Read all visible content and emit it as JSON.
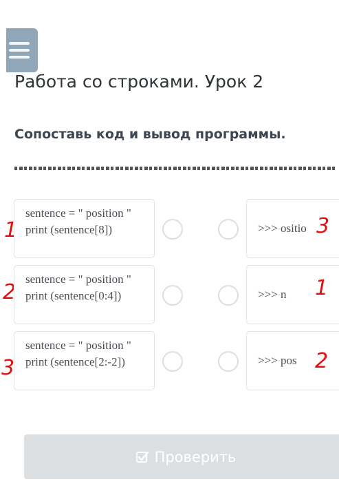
{
  "header": {
    "title": "Работа со строками. Урок 2"
  },
  "task": {
    "instruction": "Сопоставь код и вывод программы."
  },
  "left_items": [
    {
      "code": "sentence = \" position \" print (sentence[8])",
      "handwritten_mark": "1"
    },
    {
      "code": "sentence = \" position \" print (sentence[0:4])",
      "handwritten_mark": "2"
    },
    {
      "code": "sentence = \" position \" print (sentence[2:-2])",
      "handwritten_mark": "3"
    }
  ],
  "right_items": [
    {
      "output": ">>> ositio",
      "handwritten_mark": "3"
    },
    {
      "output": ">>> n",
      "handwritten_mark": "1"
    },
    {
      "output": ">>> pos",
      "handwritten_mark": "2"
    }
  ],
  "check_button": {
    "label": "Проверить",
    "icon": "check-square-icon"
  },
  "colors": {
    "menu": "#8fa7b8",
    "handwriting": "#e01010",
    "button_disabled": "#dcdfe2"
  }
}
